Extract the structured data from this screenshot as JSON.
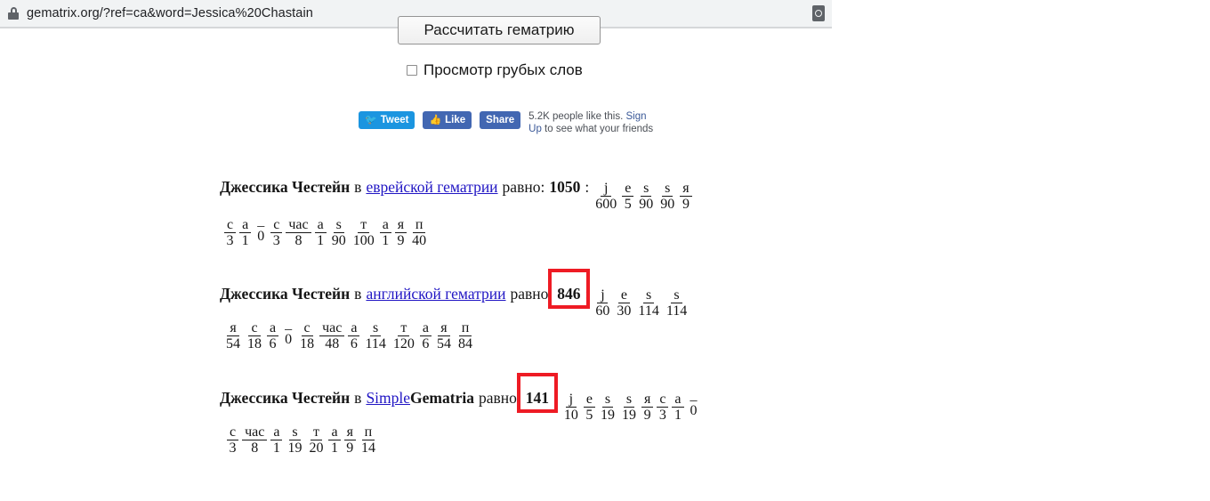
{
  "browser": {
    "url": "gematrix.org/?ref=ca&word=Jessica%20Chastain",
    "lock_icon": "lock-icon",
    "right_icon": "extension-icon"
  },
  "form": {
    "calculate_button": "Рассчитать гематрию",
    "rude_words_label": "Просмотр грубых слов",
    "rude_words_checked": false
  },
  "social": {
    "tweet_label": "Tweet",
    "like_label": "Like",
    "share_label": "Share",
    "facebook_text_1": "5.2K people like this. ",
    "facebook_link_1": "Sign Up",
    "facebook_text_2": " to see what your friends"
  },
  "results": [
    {
      "name": "Джессика Честейн",
      "in_word": "в",
      "link_text": "еврейской гематрии",
      "link_suffix": "",
      "equals_label": "равно:",
      "total": "1050",
      "colon": ":",
      "highlighted": false,
      "row1": {
        "letters": [
          "j",
          "e",
          "s",
          "s",
          "я"
        ],
        "values": [
          "600",
          "5",
          "90",
          "90",
          "9"
        ],
        "gaps": []
      },
      "row2": {
        "letters": [
          "с",
          "а",
          "_",
          "с",
          "час",
          "а",
          "s",
          "т",
          "а",
          "я",
          "п"
        ],
        "values": [
          "3",
          "1",
          "0",
          "3",
          "8",
          "1",
          "90",
          "100",
          "1",
          "9",
          "40"
        ],
        "gaps": [
          2
        ]
      }
    },
    {
      "name": "Джессика Честейн",
      "in_word": "в",
      "link_text": "английской гематрии",
      "link_suffix": "",
      "equals_label": "равно:",
      "total": "846",
      "colon": ":",
      "highlighted": true,
      "row1": {
        "letters": [
          "j",
          "e",
          "s",
          "s"
        ],
        "values": [
          "60",
          "30",
          "114",
          "114"
        ],
        "gaps": []
      },
      "row2": {
        "letters": [
          "я",
          "с",
          "а",
          "_",
          "с",
          "час",
          "а",
          "s",
          "т",
          "а",
          "я",
          "п"
        ],
        "values": [
          "54",
          "18",
          "6",
          "0",
          "18",
          "48",
          "6",
          "114",
          "120",
          "6",
          "54",
          "84"
        ],
        "gaps": [
          3
        ]
      }
    },
    {
      "name": "Джессика Честейн",
      "in_word": "в",
      "link_text": "Simple ",
      "link_suffix": "Gematria",
      "equals_label": "равно:",
      "total": "141",
      "colon": ":",
      "highlighted": true,
      "row1": {
        "letters": [
          "j",
          "e",
          "s",
          "s",
          "я",
          "с",
          "а",
          "_"
        ],
        "values": [
          "10",
          "5",
          "19",
          "19",
          "9",
          "3",
          "1",
          "0"
        ],
        "gaps": [
          7
        ]
      },
      "row2": {
        "letters": [
          "с",
          "час",
          "а",
          "s",
          "т",
          "а",
          "я",
          "п"
        ],
        "values": [
          "3",
          "8",
          "1",
          "19",
          "20",
          "1",
          "9",
          "14"
        ],
        "gaps": []
      }
    }
  ],
  "colors": {
    "link": "#2116c4",
    "highlight_box": "#ee1b24",
    "urlbar_bg": "#f1f3f4",
    "text": "#161616"
  }
}
